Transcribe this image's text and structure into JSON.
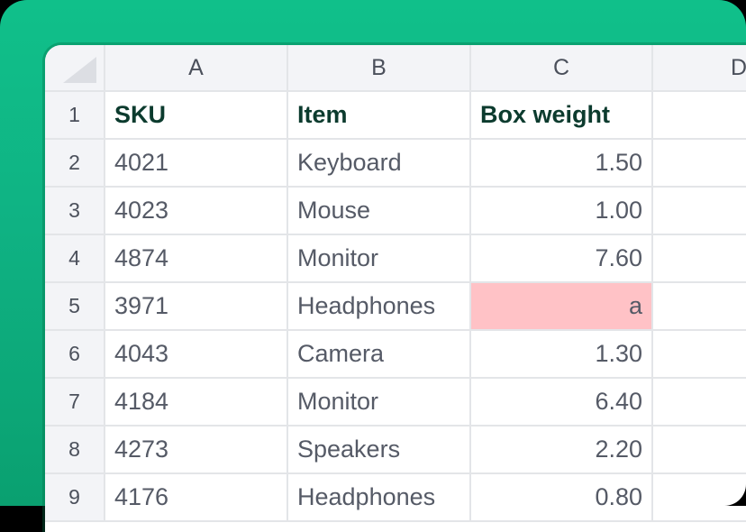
{
  "spreadsheet": {
    "column_headers": [
      "A",
      "B",
      "C",
      "D"
    ],
    "colors": {
      "background_accent": "#10c08a",
      "error_cell": "#ffc2c6",
      "header_text": "#0c3b2e"
    },
    "rows": [
      {
        "num": "1",
        "sku": "SKU",
        "item": "Item",
        "weight": "Box weight"
      },
      {
        "num": "2",
        "sku": "4021",
        "item": "Keyboard",
        "weight": "1.50"
      },
      {
        "num": "3",
        "sku": "4023",
        "item": "Mouse",
        "weight": "1.00"
      },
      {
        "num": "4",
        "sku": "4874",
        "item": "Monitor",
        "weight": "7.60"
      },
      {
        "num": "5",
        "sku": "3971",
        "item": "Headphones",
        "weight": "a",
        "weight_error": true
      },
      {
        "num": "6",
        "sku": "4043",
        "item": "Camera",
        "weight": "1.30"
      },
      {
        "num": "7",
        "sku": "4184",
        "item": "Monitor",
        "weight": "6.40"
      },
      {
        "num": "8",
        "sku": "4273",
        "item": "Speakers",
        "weight": "2.20"
      },
      {
        "num": "9",
        "sku": "4176",
        "item": "Headphones",
        "weight": "0.80"
      }
    ]
  }
}
